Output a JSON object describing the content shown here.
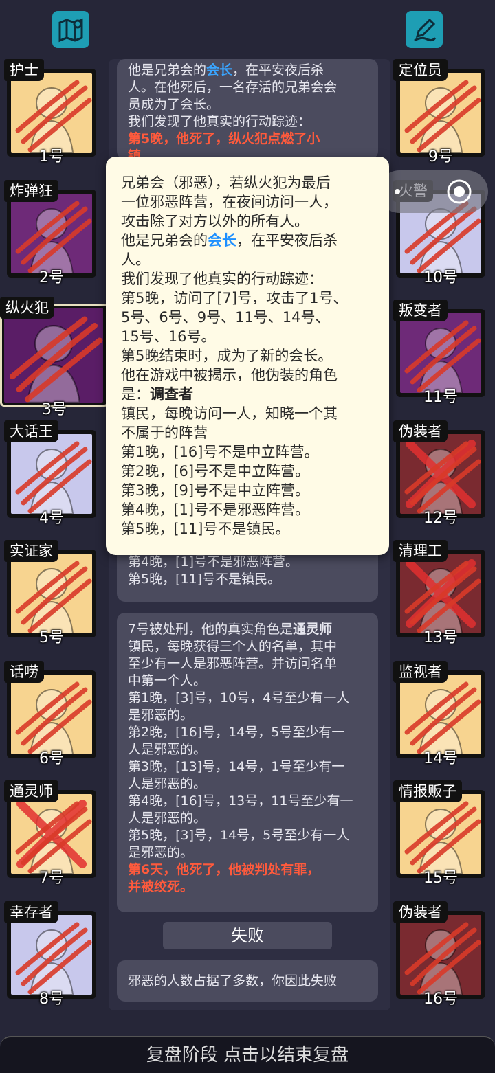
{
  "top_left_icon": "map-pin-icon",
  "top_right_icon": "edit-pen-icon",
  "left_cards": [
    {
      "title": "护士",
      "number": "1号",
      "bg": "#f7d490"
    },
    {
      "title": "炸弹狂",
      "number": "2号",
      "bg": "#6e2a78"
    },
    {
      "title": "纵火犯",
      "number": "3号",
      "bg": "#5a1d66"
    },
    {
      "title": "大话王",
      "number": "4号",
      "bg": "#c8c8ec"
    },
    {
      "title": "实证家",
      "number": "5号",
      "bg": "#f7d490"
    },
    {
      "title": "话唠",
      "number": "6号",
      "bg": "#f7d490"
    },
    {
      "title": "通灵师",
      "number": "7号",
      "bg": "#f7d490"
    },
    {
      "title": "幸存者",
      "number": "8号",
      "bg": "#c8c8ec"
    }
  ],
  "right_cards": [
    {
      "title": "定位员",
      "number": "9号",
      "bg": "#f7d490"
    },
    {
      "title": "火警",
      "number": "10号",
      "bg": "#c8c8ec"
    },
    {
      "title": "叛变者",
      "number": "11号",
      "bg": "#6e2a78"
    },
    {
      "title": "伪装者",
      "number": "12号",
      "bg": "#7a2a30"
    },
    {
      "title": "清理工",
      "number": "13号",
      "bg": "#7a2a30"
    },
    {
      "title": "监视者",
      "number": "14号",
      "bg": "#f7d490"
    },
    {
      "title": "情报贩子",
      "number": "15号",
      "bg": "#f7d490"
    },
    {
      "title": "伪装者",
      "number": "16号",
      "bg": "#7a2a30"
    }
  ],
  "log_top": {
    "l1a": "他是兄弟会的",
    "l1b": "会长",
    "l1c": "，在平安夜后杀",
    "l2": "人。在他死后，一名存活的兄弟会会",
    "l3": "员成为了会长。",
    "l4": "我们发现了他真实的行动踪迹：",
    "l5": "第5晚，他死了，纵火犯点燃了小",
    "l6": "镇"
  },
  "log_mid": {
    "l1": "第4晚，[1]号不是邪恶阵营。",
    "l2": "第5晚，[11]号不是镇民。"
  },
  "log_7": {
    "l1a": "7号被处刑，他的真实角色是",
    "l1b": "通灵师",
    "l2": "镇民，每晚获得三个人的名单，其中",
    "l3": "至少有一人是邪恶阵营。并访问名单",
    "l4": "中第一个人。",
    "l5": "第1晚，[3]号，10号，4号至少有一人",
    "l6": "是邪恶的。",
    "l7": "第2晚，[16]号，14号，5号至少有一",
    "l8": "人是邪恶的。",
    "l9": "第3晚，[13]号，14号，1号至少有一",
    "l10": "人是邪恶的。",
    "l11": "第4晚，[16]号，13号，11号至少有一",
    "l12": "人是邪恶的。",
    "l13": "第5晚，[3]号，14号，5号至少有一人",
    "l14": "是邪恶的。",
    "l15": "第6天，他死了，他被判处有罪，",
    "l16": "并被绞死。"
  },
  "fail_label": "失败",
  "fail_msg": "邪恶的人数占据了多数，你因此失败",
  "popup": {
    "l1": "兄弟会（邪恶），若纵火犯为最后",
    "l2": "一位邪恶阵营，在夜间访问一人，",
    "l3": "攻击除了对方以外的所有人。",
    "l4a": "他是兄弟会的",
    "l4b": "会长",
    "l4c": "，在平安夜后杀",
    "l5": "人。",
    "l6": "我们发现了他真实的行动踪迹：",
    "l7": "第5晚，访问了[7]号，攻击了1号、",
    "l8": "5号、6号、9号、11号、14号、",
    "l9": "15号、16号。",
    "l10": "第5晚结束时，成为了新的会长。",
    "l11": "他在游戏中被揭示，他伪装的角色",
    "l12a": "是：",
    "l12b": "调查者",
    "l13": "镇民，每晚访问一人，知晓一个其",
    "l14": "不属于的阵营",
    "l15": "第1晚，[16]号不是中立阵营。",
    "l16": "第2晚，[6]号不是中立阵营。",
    "l17": "第3晚，[9]号不是中立阵营。",
    "l18": "第4晚，[1]号不是邪恶阵营。",
    "l19": "第5晚，[11]号不是镇民。"
  },
  "bottom_bar": "复盘阶段 点击以结束复盘",
  "colors": {
    "claw": "#d93a2a",
    "cross": "#e23030",
    "bg": "#262638"
  }
}
